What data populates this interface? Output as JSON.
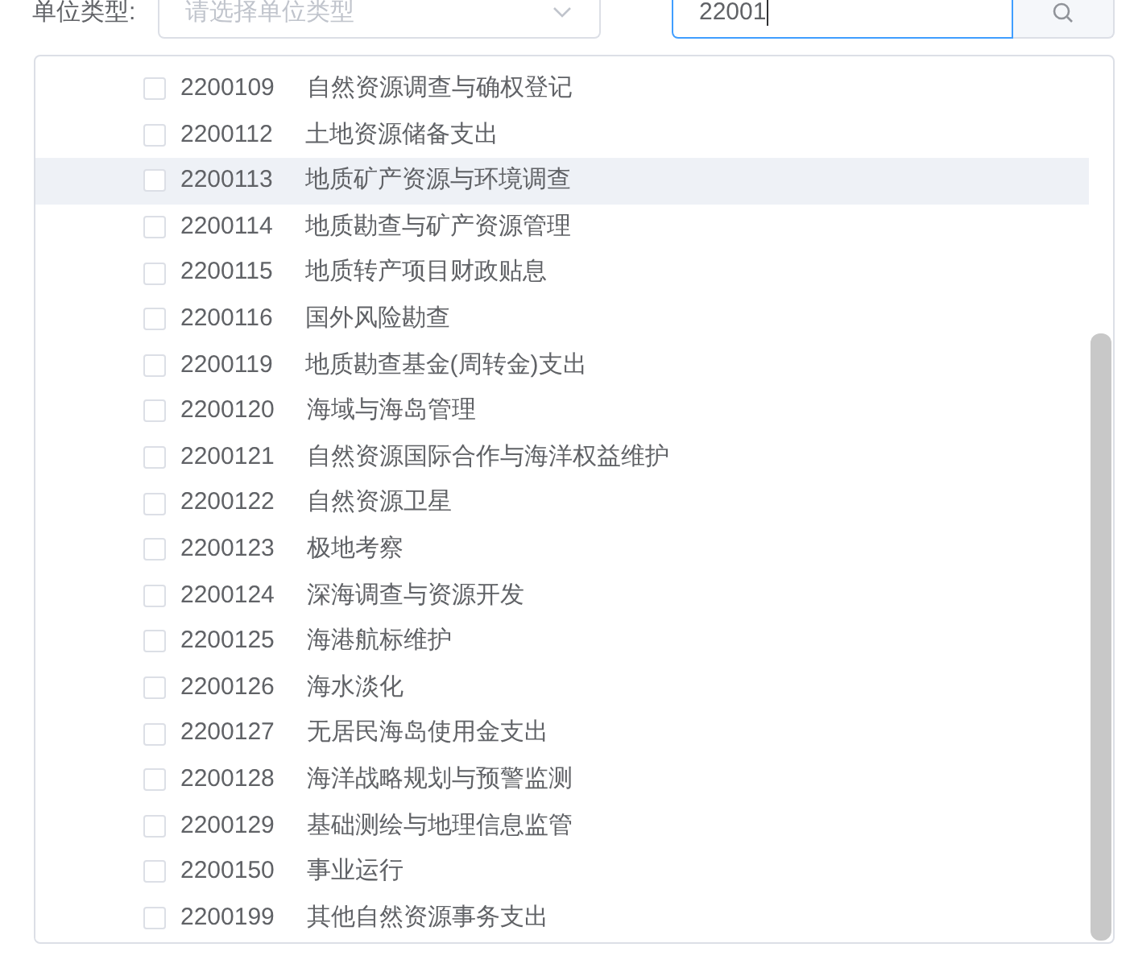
{
  "filter": {
    "label": "单位类型:",
    "select_placeholder": "请选择单位类型",
    "search_value": "22001"
  },
  "rows": [
    {
      "code": "2200109",
      "name": "自然资源调查与确权登记",
      "checked": false,
      "highlighted": false
    },
    {
      "code": "2200112",
      "name": "土地资源储备支出",
      "checked": false,
      "highlighted": false
    },
    {
      "code": "2200113",
      "name": "地质矿产资源与环境调查",
      "checked": false,
      "highlighted": true
    },
    {
      "code": "2200114",
      "name": "地质勘查与矿产资源管理",
      "checked": false,
      "highlighted": false
    },
    {
      "code": "2200115",
      "name": "地质转产项目财政贴息",
      "checked": false,
      "highlighted": false
    },
    {
      "code": "2200116",
      "name": "国外风险勘查",
      "checked": false,
      "highlighted": false
    },
    {
      "code": "2200119",
      "name": "地质勘查基金(周转金)支出",
      "checked": false,
      "highlighted": false
    },
    {
      "code": "2200120",
      "name": "海域与海岛管理",
      "checked": false,
      "highlighted": false
    },
    {
      "code": "2200121",
      "name": "自然资源国际合作与海洋权益维护",
      "checked": false,
      "highlighted": false
    },
    {
      "code": "2200122",
      "name": "自然资源卫星",
      "checked": false,
      "highlighted": false
    },
    {
      "code": "2200123",
      "name": "极地考察",
      "checked": false,
      "highlighted": false
    },
    {
      "code": "2200124",
      "name": "深海调查与资源开发",
      "checked": false,
      "highlighted": false
    },
    {
      "code": "2200125",
      "name": "海港航标维护",
      "checked": false,
      "highlighted": false
    },
    {
      "code": "2200126",
      "name": "海水淡化",
      "checked": false,
      "highlighted": false
    },
    {
      "code": "2200127",
      "name": "无居民海岛使用金支出",
      "checked": false,
      "highlighted": false
    },
    {
      "code": "2200128",
      "name": "海洋战略规划与预警监测",
      "checked": false,
      "highlighted": false
    },
    {
      "code": "2200129",
      "name": "基础测绘与地理信息监管",
      "checked": false,
      "highlighted": false
    },
    {
      "code": "2200150",
      "name": "事业运行",
      "checked": false,
      "highlighted": false
    },
    {
      "code": "2200199",
      "name": "其他自然资源事务支出",
      "checked": false,
      "highlighted": false
    }
  ]
}
